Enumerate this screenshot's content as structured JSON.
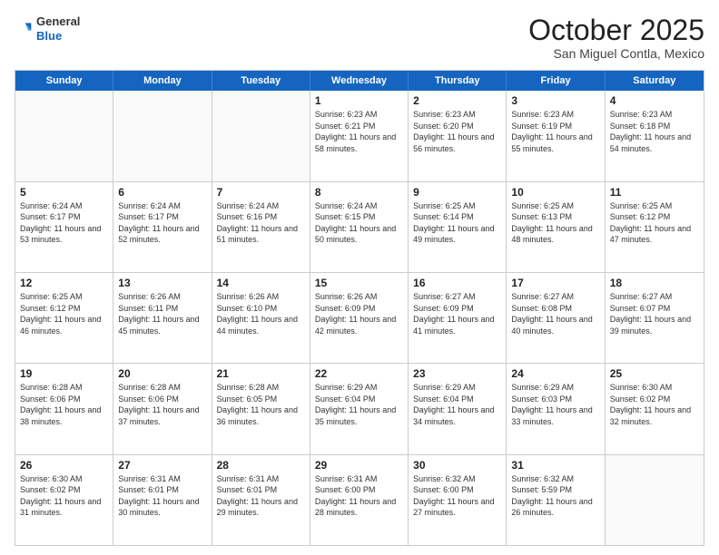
{
  "header": {
    "logo_general": "General",
    "logo_blue": "Blue",
    "month_title": "October 2025",
    "location": "San Miguel Contla, Mexico"
  },
  "calendar": {
    "days_of_week": [
      "Sunday",
      "Monday",
      "Tuesday",
      "Wednesday",
      "Thursday",
      "Friday",
      "Saturday"
    ],
    "rows": [
      [
        {
          "day": "",
          "empty": true
        },
        {
          "day": "",
          "empty": true
        },
        {
          "day": "",
          "empty": true
        },
        {
          "day": "1",
          "sunrise": "6:23 AM",
          "sunset": "6:21 PM",
          "daylight": "11 hours and 58 minutes."
        },
        {
          "day": "2",
          "sunrise": "6:23 AM",
          "sunset": "6:20 PM",
          "daylight": "11 hours and 56 minutes."
        },
        {
          "day": "3",
          "sunrise": "6:23 AM",
          "sunset": "6:19 PM",
          "daylight": "11 hours and 55 minutes."
        },
        {
          "day": "4",
          "sunrise": "6:23 AM",
          "sunset": "6:18 PM",
          "daylight": "11 hours and 54 minutes."
        }
      ],
      [
        {
          "day": "5",
          "sunrise": "6:24 AM",
          "sunset": "6:17 PM",
          "daylight": "11 hours and 53 minutes."
        },
        {
          "day": "6",
          "sunrise": "6:24 AM",
          "sunset": "6:17 PM",
          "daylight": "11 hours and 52 minutes."
        },
        {
          "day": "7",
          "sunrise": "6:24 AM",
          "sunset": "6:16 PM",
          "daylight": "11 hours and 51 minutes."
        },
        {
          "day": "8",
          "sunrise": "6:24 AM",
          "sunset": "6:15 PM",
          "daylight": "11 hours and 50 minutes."
        },
        {
          "day": "9",
          "sunrise": "6:25 AM",
          "sunset": "6:14 PM",
          "daylight": "11 hours and 49 minutes."
        },
        {
          "day": "10",
          "sunrise": "6:25 AM",
          "sunset": "6:13 PM",
          "daylight": "11 hours and 48 minutes."
        },
        {
          "day": "11",
          "sunrise": "6:25 AM",
          "sunset": "6:12 PM",
          "daylight": "11 hours and 47 minutes."
        }
      ],
      [
        {
          "day": "12",
          "sunrise": "6:25 AM",
          "sunset": "6:12 PM",
          "daylight": "11 hours and 46 minutes."
        },
        {
          "day": "13",
          "sunrise": "6:26 AM",
          "sunset": "6:11 PM",
          "daylight": "11 hours and 45 minutes."
        },
        {
          "day": "14",
          "sunrise": "6:26 AM",
          "sunset": "6:10 PM",
          "daylight": "11 hours and 44 minutes."
        },
        {
          "day": "15",
          "sunrise": "6:26 AM",
          "sunset": "6:09 PM",
          "daylight": "11 hours and 42 minutes."
        },
        {
          "day": "16",
          "sunrise": "6:27 AM",
          "sunset": "6:09 PM",
          "daylight": "11 hours and 41 minutes."
        },
        {
          "day": "17",
          "sunrise": "6:27 AM",
          "sunset": "6:08 PM",
          "daylight": "11 hours and 40 minutes."
        },
        {
          "day": "18",
          "sunrise": "6:27 AM",
          "sunset": "6:07 PM",
          "daylight": "11 hours and 39 minutes."
        }
      ],
      [
        {
          "day": "19",
          "sunrise": "6:28 AM",
          "sunset": "6:06 PM",
          "daylight": "11 hours and 38 minutes."
        },
        {
          "day": "20",
          "sunrise": "6:28 AM",
          "sunset": "6:06 PM",
          "daylight": "11 hours and 37 minutes."
        },
        {
          "day": "21",
          "sunrise": "6:28 AM",
          "sunset": "6:05 PM",
          "daylight": "11 hours and 36 minutes."
        },
        {
          "day": "22",
          "sunrise": "6:29 AM",
          "sunset": "6:04 PM",
          "daylight": "11 hours and 35 minutes."
        },
        {
          "day": "23",
          "sunrise": "6:29 AM",
          "sunset": "6:04 PM",
          "daylight": "11 hours and 34 minutes."
        },
        {
          "day": "24",
          "sunrise": "6:29 AM",
          "sunset": "6:03 PM",
          "daylight": "11 hours and 33 minutes."
        },
        {
          "day": "25",
          "sunrise": "6:30 AM",
          "sunset": "6:02 PM",
          "daylight": "11 hours and 32 minutes."
        }
      ],
      [
        {
          "day": "26",
          "sunrise": "6:30 AM",
          "sunset": "6:02 PM",
          "daylight": "11 hours and 31 minutes."
        },
        {
          "day": "27",
          "sunrise": "6:31 AM",
          "sunset": "6:01 PM",
          "daylight": "11 hours and 30 minutes."
        },
        {
          "day": "28",
          "sunrise": "6:31 AM",
          "sunset": "6:01 PM",
          "daylight": "11 hours and 29 minutes."
        },
        {
          "day": "29",
          "sunrise": "6:31 AM",
          "sunset": "6:00 PM",
          "daylight": "11 hours and 28 minutes."
        },
        {
          "day": "30",
          "sunrise": "6:32 AM",
          "sunset": "6:00 PM",
          "daylight": "11 hours and 27 minutes."
        },
        {
          "day": "31",
          "sunrise": "6:32 AM",
          "sunset": "5:59 PM",
          "daylight": "11 hours and 26 minutes."
        },
        {
          "day": "",
          "empty": true
        }
      ]
    ]
  }
}
